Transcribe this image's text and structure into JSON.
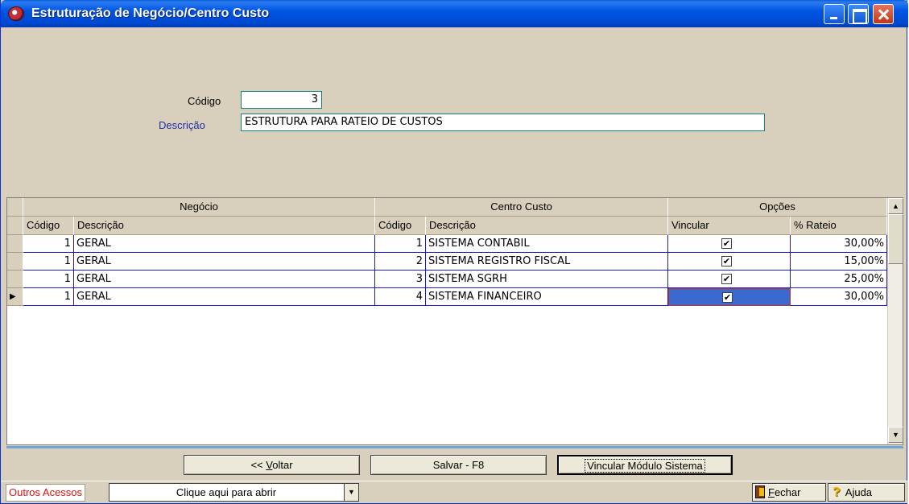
{
  "window": {
    "title": "Estruturação de Negócio/Centro Custo",
    "icon": "app-logo-icon"
  },
  "form": {
    "codigo_label": "Código",
    "codigo_value": "3",
    "descricao_label": "Descrição",
    "descricao_value": "ESTRUTURA PARA RATEIO DE CUSTOS"
  },
  "grid": {
    "groups": [
      "Negócio",
      "Centro Custo",
      "Opções"
    ],
    "columns": [
      "Código",
      "Descrição",
      "Código",
      "Descrição",
      "Vincular",
      "% Rateio"
    ],
    "rows": [
      {
        "neg_codigo": "1",
        "neg_descricao": "GERAL",
        "cc_codigo": "1",
        "cc_descricao": "SISTEMA CONTABIL",
        "vincular": "✔",
        "rateio": "30,00%"
      },
      {
        "neg_codigo": "1",
        "neg_descricao": "GERAL",
        "cc_codigo": "2",
        "cc_descricao": "SISTEMA REGISTRO FISCAL",
        "vincular": "✔",
        "rateio": "15,00%"
      },
      {
        "neg_codigo": "1",
        "neg_descricao": "GERAL",
        "cc_codigo": "3",
        "cc_descricao": "SISTEMA SGRH",
        "vincular": "✔",
        "rateio": "25,00%"
      },
      {
        "neg_codigo": "1",
        "neg_descricao": "GERAL",
        "cc_codigo": "4",
        "cc_descricao": "SISTEMA FINANCEIRO",
        "vincular": "✔",
        "rateio": "30,00%"
      }
    ],
    "current_row_marker": "▶",
    "scroll_up": "▲",
    "scroll_down": "▼"
  },
  "buttons": {
    "voltar_prefix": "<< ",
    "voltar_u": "V",
    "voltar_rest": "oltar",
    "salvar": "Salvar - F8",
    "vincular": "Vincular Módulo Sistema"
  },
  "statusbar": {
    "outros_label": "Outros Acessos",
    "combo_value": "Clique aqui para abrir",
    "combo_arrow": "▼",
    "fechar_u": "F",
    "fechar_rest": "echar",
    "ajuda_icon": "?",
    "ajuda": "Ajuda"
  },
  "colors": {
    "title_bar": "#0054e3",
    "window_bg": "#d8d0bc",
    "grid_lines": "#1a1ac8",
    "selected_cell": "#3a6ad0",
    "label_blue": "#1f2ea8",
    "outros_red": "#e01010"
  }
}
